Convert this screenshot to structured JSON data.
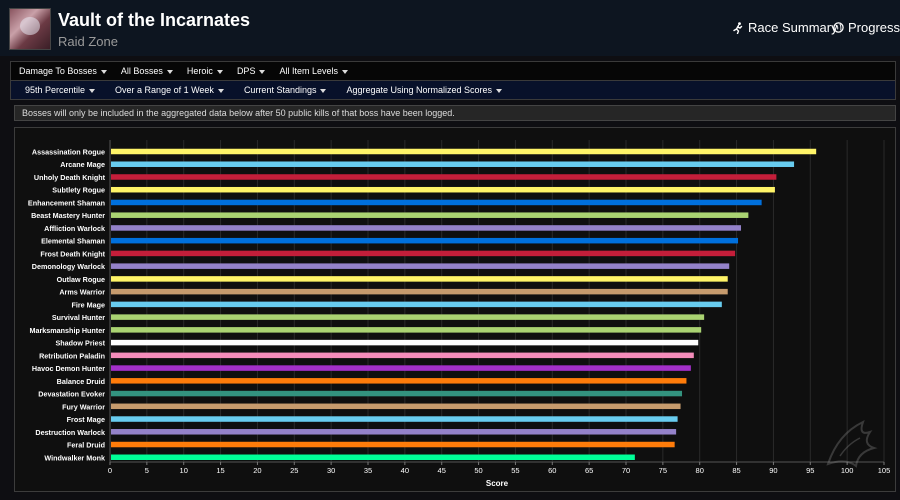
{
  "header": {
    "title": "Vault of the Incarnates",
    "subtitle": "Raid Zone",
    "nav": [
      {
        "label": "Race Summary",
        "icon": "runner-icon"
      },
      {
        "label": "Progress",
        "icon": "globe-icon"
      }
    ]
  },
  "filters_row1": [
    "Damage To Bosses",
    "All Bosses",
    "Heroic",
    "DPS",
    "All Item Levels"
  ],
  "filters_row2": [
    "95th Percentile",
    "Over a Range of 1 Week",
    "Current Standings",
    "Aggregate Using Normalized Scores"
  ],
  "notice": "Bosses will only be included in the aggregated data below after 50 public kills of that boss have been logged.",
  "chart_data": {
    "type": "bar",
    "orientation": "horizontal",
    "title": "",
    "xlabel": "Score",
    "ylabel": "",
    "xlim": [
      0,
      105
    ],
    "xticks": [
      0,
      5,
      10,
      15,
      20,
      25,
      30,
      35,
      40,
      45,
      50,
      55,
      60,
      65,
      70,
      75,
      80,
      85,
      90,
      95,
      100,
      105
    ],
    "grid": true,
    "categories": [
      "Assassination Rogue",
      "Arcane Mage",
      "Unholy Death Knight",
      "Subtlety Rogue",
      "Enhancement Shaman",
      "Beast Mastery Hunter",
      "Affliction Warlock",
      "Elemental Shaman",
      "Frost Death Knight",
      "Demonology Warlock",
      "Outlaw Rogue",
      "Arms Warrior",
      "Fire Mage",
      "Survival Hunter",
      "Marksmanship Hunter",
      "Shadow Priest",
      "Retribution Paladin",
      "Havoc Demon Hunter",
      "Balance Druid",
      "Devastation Evoker",
      "Fury Warrior",
      "Frost Mage",
      "Destruction Warlock",
      "Feral Druid",
      "Windwalker Monk"
    ],
    "values": [
      95.8,
      92.8,
      90.4,
      90.2,
      88.4,
      86.6,
      85.6,
      85.2,
      84.8,
      84.0,
      83.8,
      83.8,
      83.0,
      80.6,
      80.2,
      79.8,
      79.2,
      78.8,
      78.2,
      77.6,
      77.4,
      77.0,
      76.8,
      76.6,
      71.2
    ],
    "colors": [
      "#FFF468",
      "#68CCEF",
      "#C41E3A",
      "#FFF468",
      "#0070DD",
      "#AAD372",
      "#9482C9",
      "#0070DD",
      "#C41E3A",
      "#9482C9",
      "#FFF468",
      "#C69B6D",
      "#68CCEF",
      "#AAD372",
      "#AAD372",
      "#FFFFFF",
      "#F48CBA",
      "#A330C9",
      "#FF7C0A",
      "#33937F",
      "#C69B6D",
      "#68CCEF",
      "#9482C9",
      "#FF7C0A",
      "#00FF98"
    ]
  }
}
